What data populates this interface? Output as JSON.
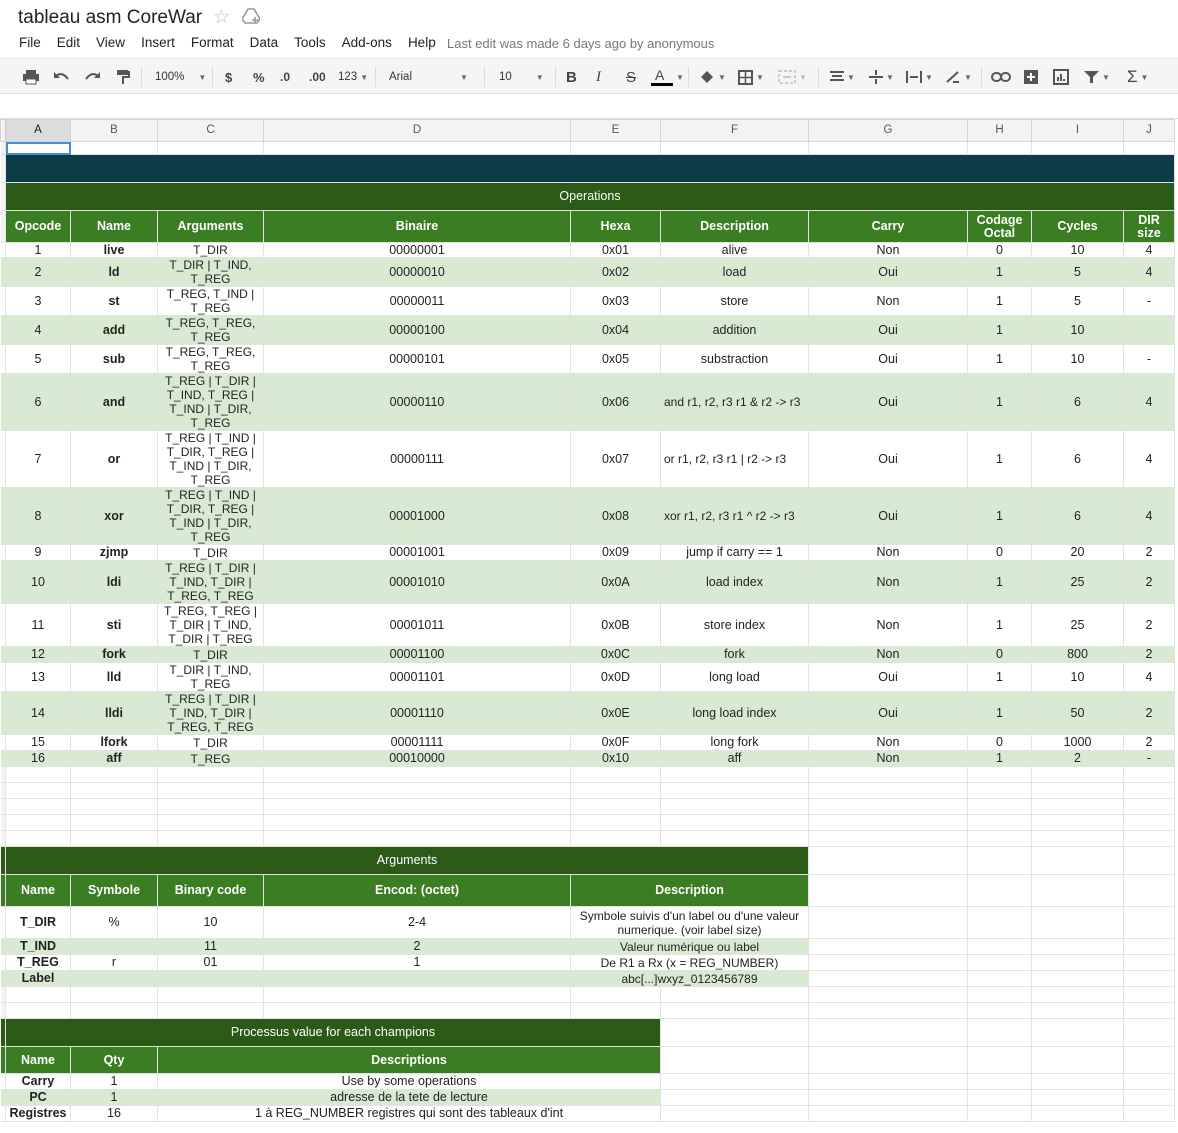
{
  "app": {
    "doc_title": "tableau asm CoreWar",
    "menus": [
      "File",
      "Edit",
      "View",
      "Insert",
      "Format",
      "Data",
      "Tools",
      "Add-ons",
      "Help"
    ],
    "last_edit": "Last edit was made 6 days ago by anonymous"
  },
  "toolbar": {
    "zoom": "100%",
    "currency": "$",
    "percent": "%",
    "dec_decrease": ".0",
    "dec_increase": ".00",
    "more_formats": "123",
    "font": "Arial",
    "font_size": "10"
  },
  "columns": [
    "A",
    "B",
    "C",
    "D",
    "E",
    "F",
    "G",
    "H",
    "I",
    "J"
  ],
  "operations": {
    "title": "Operations",
    "headers": [
      "Opcode",
      "Name",
      "Arguments",
      "Binaire",
      "Hexa",
      "Description",
      "Carry",
      "Codage Octal",
      "Cycles",
      "DIR size"
    ],
    "rows": [
      [
        "1",
        "live",
        "T_DIR",
        "00000001",
        "0x01",
        "alive",
        "Non",
        "0",
        "10",
        "4"
      ],
      [
        "2",
        "ld",
        "T_DIR | T_IND, T_REG",
        "00000010",
        "0x02",
        "load",
        "Oui",
        "1",
        "5",
        "4"
      ],
      [
        "3",
        "st",
        "T_REG, T_IND | T_REG",
        "00000011",
        "0x03",
        "store",
        "Non",
        "1",
        "5",
        "-"
      ],
      [
        "4",
        "add",
        "T_REG, T_REG, T_REG",
        "00000100",
        "0x04",
        "addition",
        "Oui",
        "1",
        "10",
        ""
      ],
      [
        "5",
        "sub",
        "T_REG, T_REG, T_REG",
        "00000101",
        "0x05",
        "substraction",
        "Oui",
        "1",
        "10",
        "-"
      ],
      [
        "6",
        "and",
        "T_REG | T_DIR | T_IND, T_REG | T_IND | T_DIR, T_REG",
        "00000110",
        "0x06",
        "and   r1, r2, r3   r1 & r2 -> r3",
        "Oui",
        "1",
        "6",
        "4"
      ],
      [
        "7",
        "or",
        "T_REG | T_IND | T_DIR, T_REG | T_IND | T_DIR, T_REG",
        "00000111",
        "0x07",
        "or   r1, r2, r3   r1 | r2 -> r3",
        "Oui",
        "1",
        "6",
        "4"
      ],
      [
        "8",
        "xor",
        "T_REG | T_IND | T_DIR, T_REG | T_IND | T_DIR, T_REG",
        "00001000",
        "0x08",
        "xor  r1, r2, r3   r1 ^ r2 -> r3",
        "Oui",
        "1",
        "6",
        "4"
      ],
      [
        "9",
        "zjmp",
        "T_DIR",
        "00001001",
        "0x09",
        "jump if carry == 1",
        "Non",
        "0",
        "20",
        "2"
      ],
      [
        "10",
        "ldi",
        "T_REG | T_DIR | T_IND, T_DIR | T_REG, T_REG",
        "00001010",
        "0x0A",
        "load index",
        "Non",
        "1",
        "25",
        "2"
      ],
      [
        "11",
        "sti",
        "T_REG, T_REG | T_DIR | T_IND, T_DIR | T_REG",
        "00001011",
        "0x0B",
        "store index",
        "Non",
        "1",
        "25",
        "2"
      ],
      [
        "12",
        "fork",
        "T_DIR",
        "00001100",
        "0x0C",
        "fork",
        "Non",
        "0",
        "800",
        "2"
      ],
      [
        "13",
        "lld",
        "T_DIR | T_IND, T_REG",
        "00001101",
        "0x0D",
        "long load",
        "Oui",
        "1",
        "10",
        "4"
      ],
      [
        "14",
        "lldi",
        "T_REG | T_DIR | T_IND, T_DIR | T_REG, T_REG",
        "00001110",
        "0x0E",
        "long load index",
        "Oui",
        "1",
        "50",
        "2"
      ],
      [
        "15",
        "lfork",
        "T_DIR",
        "00001111",
        "0x0F",
        "long fork",
        "Non",
        "0",
        "1000",
        "2"
      ],
      [
        "16",
        "aff",
        "T_REG",
        "00010000",
        "0x10",
        "aff",
        "Non",
        "1",
        "2",
        "-"
      ]
    ]
  },
  "arguments": {
    "title": "Arguments",
    "headers": [
      "Name",
      "Symbole",
      "Binary code",
      "Encod: (octet)",
      "Description"
    ],
    "rows": [
      [
        "T_DIR",
        "%",
        "10",
        "2-4",
        "Symbole suivis d'un label ou d'une valeur numerique. (voir label size)"
      ],
      [
        "T_IND",
        "",
        "11",
        "2",
        "Valeur numérique ou label"
      ],
      [
        "T_REG",
        "r",
        "01",
        "1",
        "De R1 a Rx (x = REG_NUMBER)"
      ],
      [
        "Label",
        "",
        "",
        "",
        "abc[...]wxyz_0123456789"
      ]
    ]
  },
  "processus": {
    "title": "Processus value for each champions",
    "headers": [
      "Name",
      "Qty",
      "Descriptions"
    ],
    "rows": [
      [
        "Carry",
        "1",
        "Use by some operations"
      ],
      [
        "PC",
        "1",
        "adresse de la tete de lecture"
      ],
      [
        "Registres",
        "16",
        "1 à REG_NUMBER registres qui sont des tableaux d'int"
      ]
    ]
  }
}
